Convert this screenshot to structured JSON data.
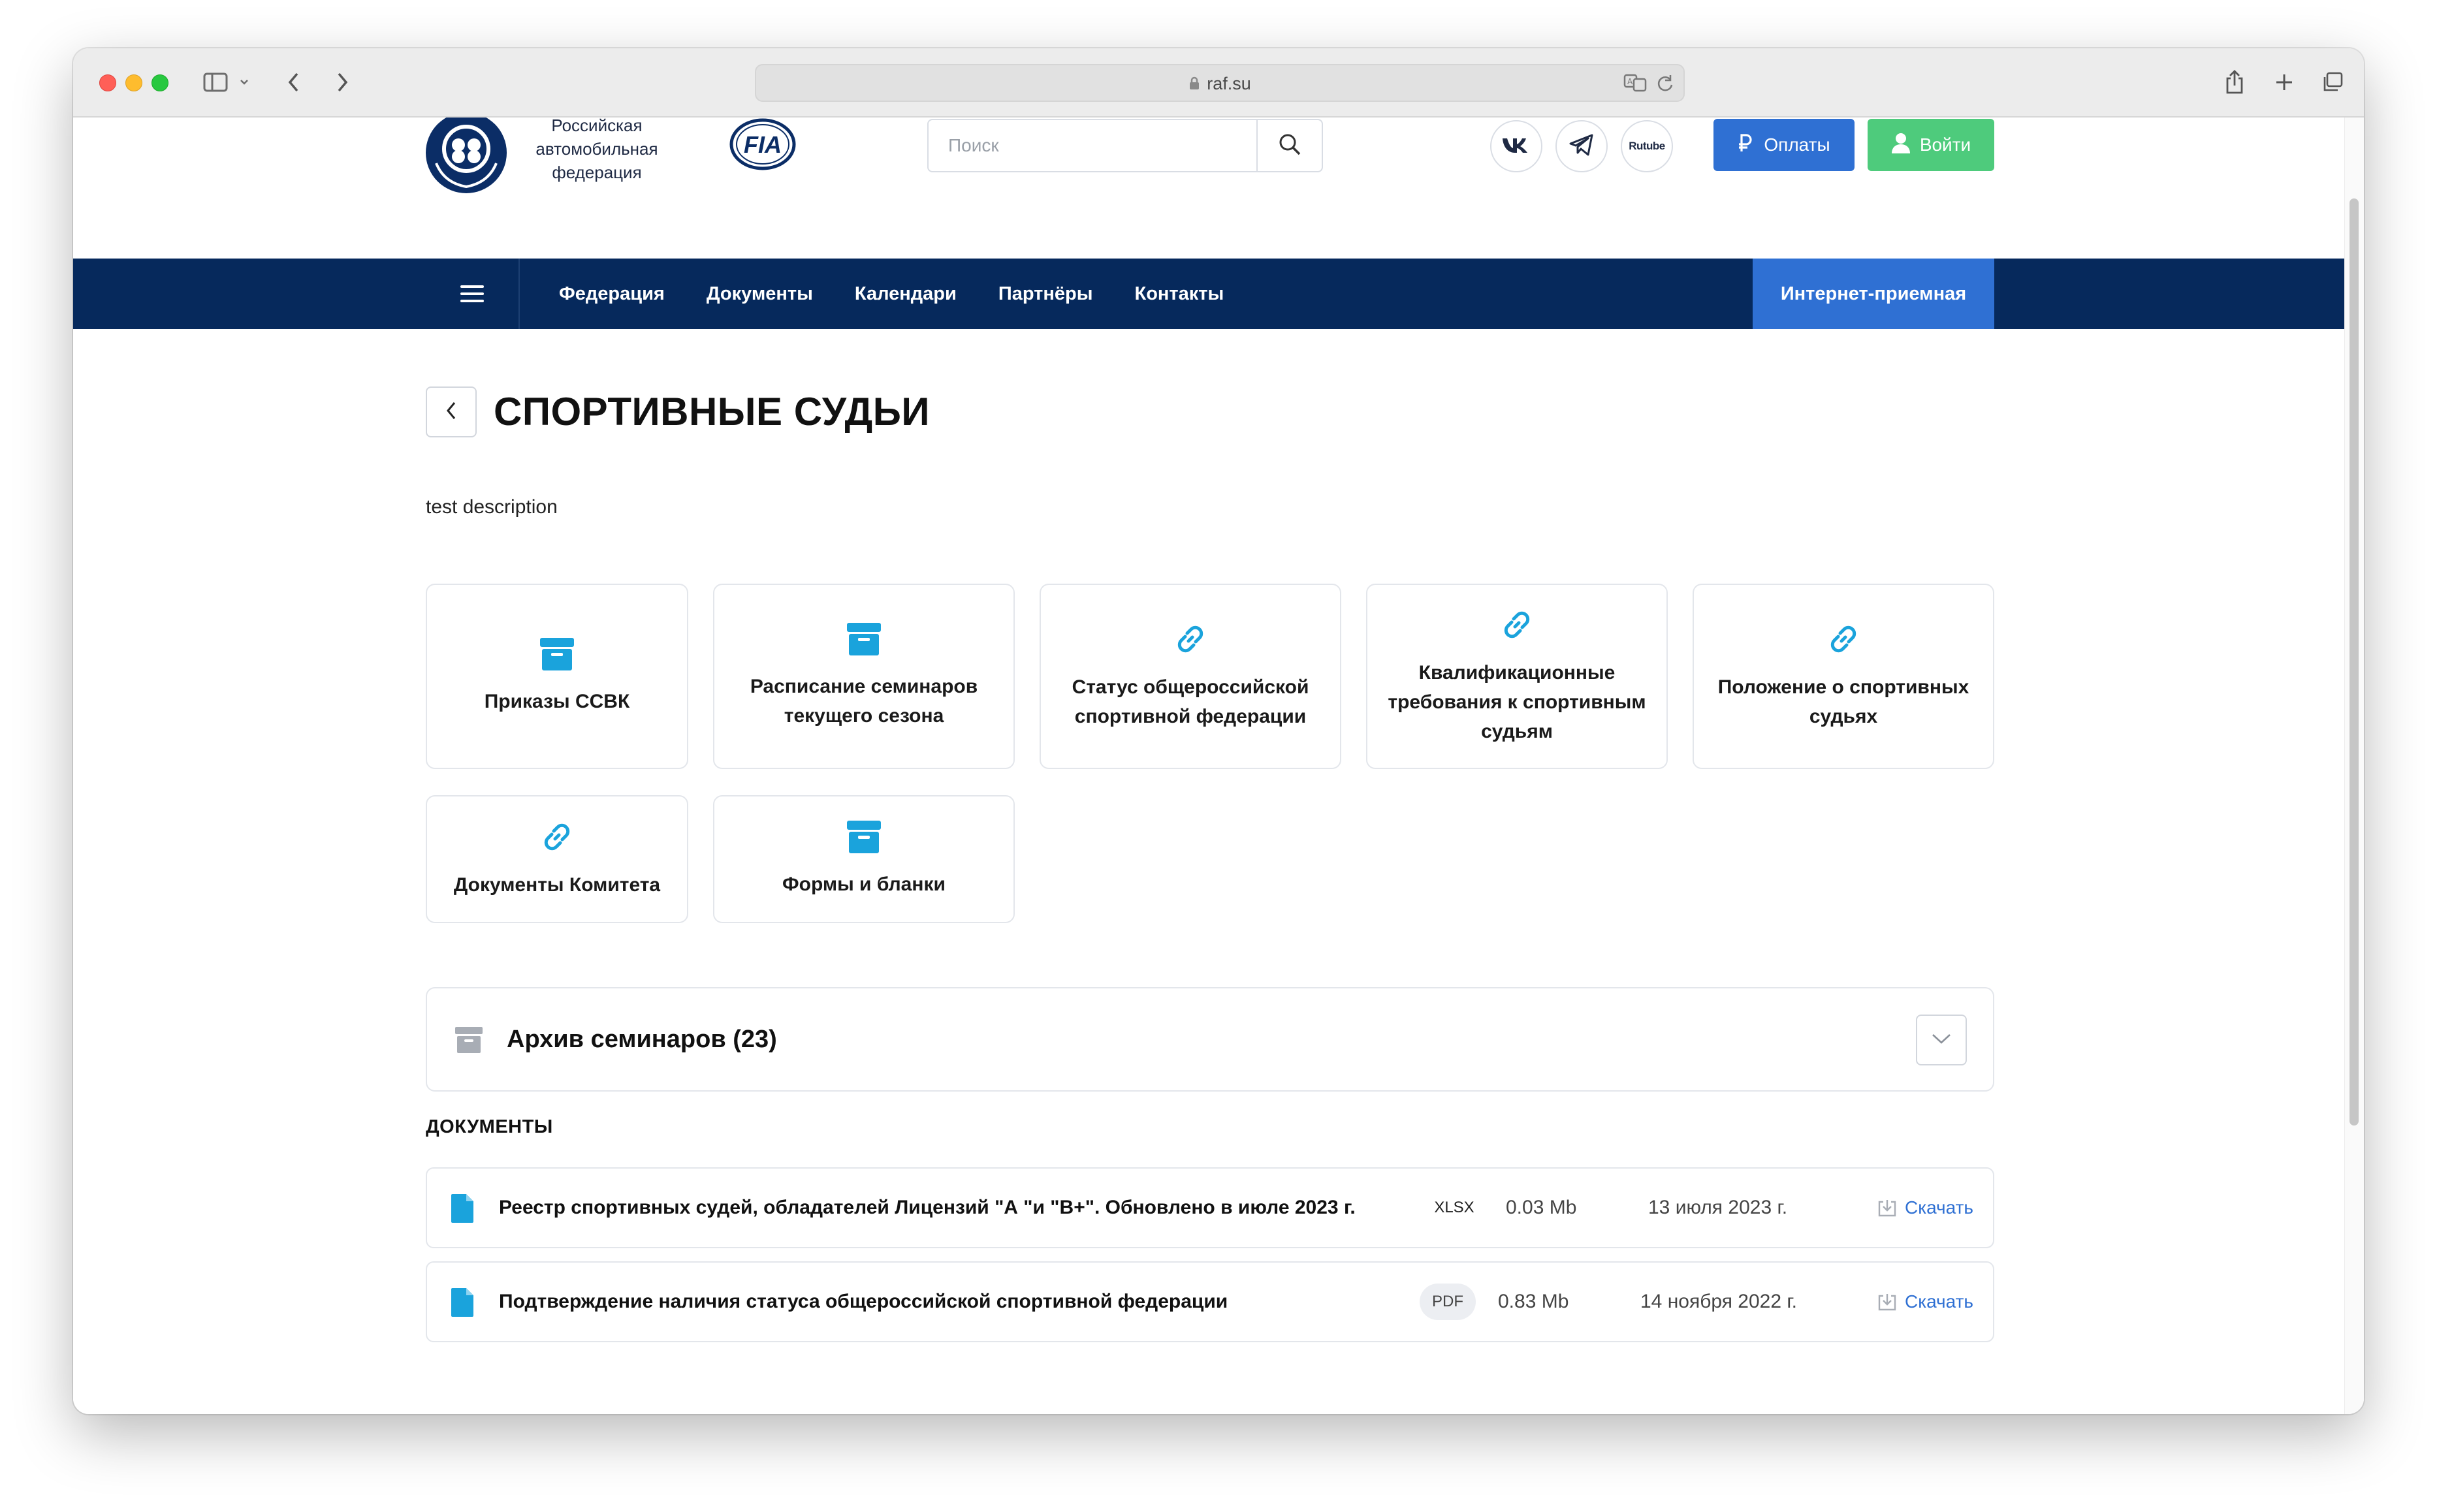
{
  "browser": {
    "url": "raf.su"
  },
  "header": {
    "logo_text": [
      "Российская",
      "автомобильная",
      "федерация"
    ],
    "fia_logo_text": "FIA",
    "search_placeholder": "Поиск",
    "social": {
      "rutube_label": "Rutube"
    },
    "pay_button": "Оплаты",
    "login_button": "Войти"
  },
  "nav": {
    "items": [
      "Федерация",
      "Документы",
      "Календари",
      "Партнёры",
      "Контакты"
    ],
    "cta": "Интернет-приемная"
  },
  "page": {
    "title": "СПОРТИВНЫЕ СУДЬИ",
    "description": "test description"
  },
  "cards": [
    {
      "icon": "archive-icon",
      "label": "Приказы ССВК"
    },
    {
      "icon": "archive-icon",
      "label": "Расписание семинаров текущего сезона"
    },
    {
      "icon": "link-icon",
      "label": "Статус общероссийской спортивной федерации"
    },
    {
      "icon": "link-icon",
      "label": "Квалификационные требования к спортивным судьям"
    },
    {
      "icon": "link-icon",
      "label": "Положение о спортивных судьях"
    },
    {
      "icon": "link-icon",
      "label": "Документы Комитета"
    },
    {
      "icon": "archive-icon",
      "label": "Формы и бланки"
    }
  ],
  "archive": {
    "title": "Архив семинаров (23)"
  },
  "documents": {
    "heading": "ДОКУМЕНТЫ",
    "download_label": "Скачать",
    "rows": [
      {
        "name": "Реестр спортивных судей, обладателей Лицензий \"А \"и \"В+\". Обновлено в июле 2023 г.",
        "type": "XLSX",
        "size": "0.03 Mb",
        "date": "13 июля 2023 г."
      },
      {
        "name": "Подтверждение наличия статуса общероссийской спортивной федерации",
        "type": "PDF",
        "size": "0.83 Mb",
        "date": "14 ноября 2022 г."
      }
    ]
  },
  "colors": {
    "nav_bg": "#06295c",
    "accent_blue": "#2f70d3",
    "login_green": "#4ecb7c",
    "icon_cyan": "#1aa3dc"
  }
}
